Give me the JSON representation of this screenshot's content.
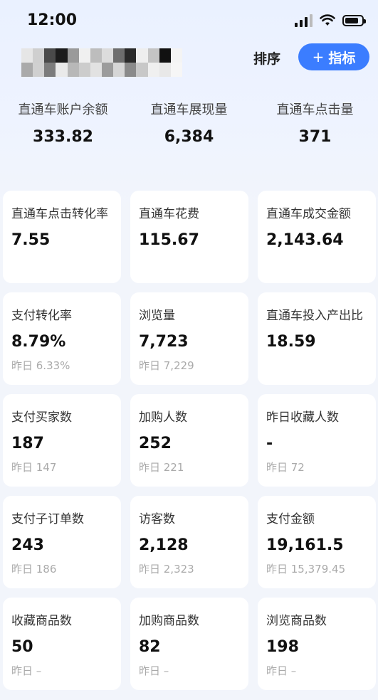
{
  "status_bar": {
    "time": "12:00"
  },
  "header": {
    "sort_label": "排序",
    "add_plus": "+",
    "add_label": "指标"
  },
  "summary": [
    {
      "label": "直通车账户余额",
      "value": "333.82"
    },
    {
      "label": "直通车展现量",
      "value": "6,384"
    },
    {
      "label": "直通车点击量",
      "value": "371"
    }
  ],
  "cards": [
    {
      "label": "直通车点击转化率",
      "value": "7.55",
      "sub": ""
    },
    {
      "label": "直通车花费",
      "value": "115.67",
      "sub": ""
    },
    {
      "label": "直通车成交金额",
      "value": "2,143.64",
      "sub": ""
    },
    {
      "label": "支付转化率",
      "value": "8.79%",
      "sub": "昨日 6.33%"
    },
    {
      "label": "浏览量",
      "value": "7,723",
      "sub": "昨日 7,229"
    },
    {
      "label": "直通车投入产出比",
      "value": "18.59",
      "sub": ""
    },
    {
      "label": "支付买家数",
      "value": "187",
      "sub": "昨日 147"
    },
    {
      "label": "加购人数",
      "value": "252",
      "sub": "昨日 221"
    },
    {
      "label": "昨日收藏人数",
      "value": "-",
      "sub": "昨日 72"
    },
    {
      "label": "支付子订单数",
      "value": "243",
      "sub": "昨日 186"
    },
    {
      "label": "访客数",
      "value": "2,128",
      "sub": "昨日 2,323"
    },
    {
      "label": "支付金额",
      "value": "19,161.5",
      "sub": "昨日 15,379.45"
    },
    {
      "label": "收藏商品数",
      "value": "50",
      "sub": "昨日 –"
    },
    {
      "label": "加购商品数",
      "value": "82",
      "sub": "昨日 –"
    },
    {
      "label": "浏览商品数",
      "value": "198",
      "sub": "昨日 –"
    }
  ]
}
